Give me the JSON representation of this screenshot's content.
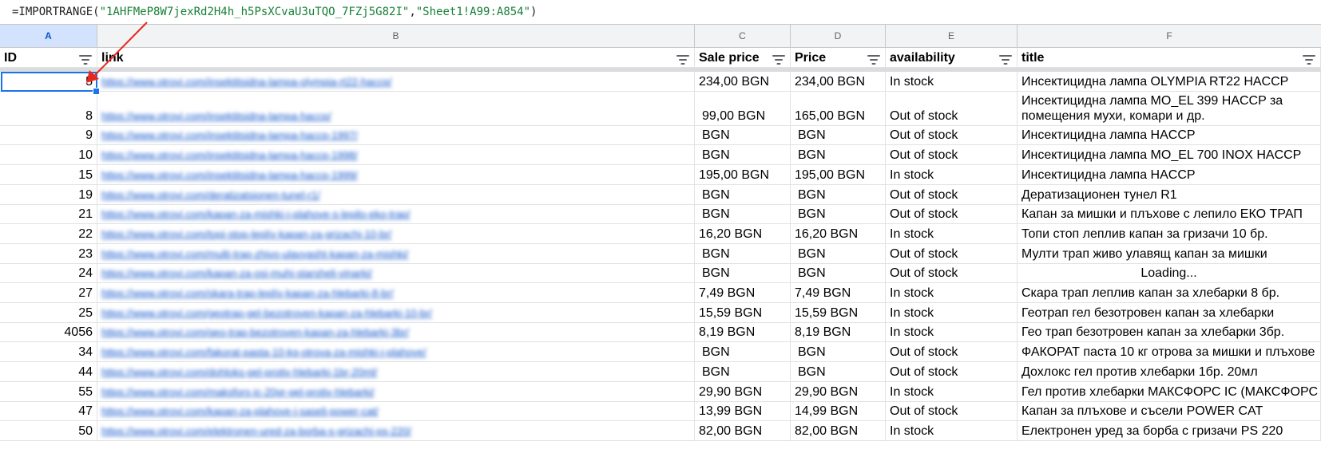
{
  "formula": {
    "prefix": "=IMPORTRANGE(",
    "arg1": "\"1AHFMeP8W7jexRd2H4h_h5PsXCvaU3uTQO_7FZj5G82I\"",
    "sep": ",",
    "arg2": "\"Sheet1!A99:A854\"",
    "suffix": ")"
  },
  "columns": [
    "A",
    "B",
    "C",
    "D",
    "E",
    "F"
  ],
  "headers": [
    "ID",
    "link",
    "Sale price",
    "Price",
    "availability",
    "title"
  ],
  "rows": [
    {
      "id": "5",
      "link": "https://www.otrovi.com/insektitsidna-lampa-olympia-rt22-haccp/",
      "sale": "234,00 BGN",
      "price": "234,00 BGN",
      "avail": "In stock",
      "title": "Инсектицидна лампа OLYMPIA RT22 HACCP"
    },
    {
      "id": "8",
      "link": "https://www.otrovi.com/insektitsidna-lampa-haccp/",
      "sale": "99,00 BGN",
      "price": "165,00 BGN",
      "avail": "Out of stock",
      "title": "Инсектицидна лампа MO_EL 399 HACCP за",
      "title2": "помещения мухи, комари и др."
    },
    {
      "id": "9",
      "link": "https://www.otrovi.com/insektitsidna-lampa-haccp-1997/",
      "sale": "BGN",
      "price": "BGN",
      "avail": "Out of stock",
      "title": "Инсектицидна лампа HACCP"
    },
    {
      "id": "10",
      "link": "https://www.otrovi.com/insektitsidna-lampa-haccp-1998/",
      "sale": "BGN",
      "price": "BGN",
      "avail": "Out of stock",
      "title": "Инсектицидна лампа MO_EL 700 INOX HACCP"
    },
    {
      "id": "15",
      "link": "https://www.otrovi.com/insektitsidna-lampa-haccp-1999/",
      "sale": "195,00 BGN",
      "price": "195,00 BGN",
      "avail": "In stock",
      "title": "Инсектицидна лампа HACCP"
    },
    {
      "id": "19",
      "link": "https://www.otrovi.com/deratizatsionen-tunel-r1/",
      "sale": "BGN",
      "price": "BGN",
      "avail": "Out of stock",
      "title": "Дератизационен тунел R1"
    },
    {
      "id": "21",
      "link": "https://www.otrovi.com/kapan-za-mishki-i-plahove-s-lepilo-eko-trap/",
      "sale": "BGN",
      "price": "BGN",
      "avail": "Out of stock",
      "title": "Капан за мишки и плъхове с лепило ЕКО ТРАП"
    },
    {
      "id": "22",
      "link": "https://www.otrovi.com/topi-stop-leplív-kapan-za-grizachi-10-br/",
      "sale": "16,20  BGN",
      "price": "16,20  BGN",
      "avail": "In stock",
      "title": "Топи стоп леплив капан за гризачи 10 бр."
    },
    {
      "id": "23",
      "link": "https://www.otrovi.com/multi-trap-zhivo-ulavyasht-kapan-za-mishki/",
      "sale": "BGN",
      "price": "BGN",
      "avail": "Out of stock",
      "title": "Мулти трап живо улавящ капан за мишки"
    },
    {
      "id": "24",
      "link": "https://www.otrovi.com/kapan-za-osi-muhi-starsheli-vinarki/",
      "sale": "BGN",
      "price": "BGN",
      "avail": "Out of stock",
      "title": "Loading...",
      "loading": true
    },
    {
      "id": "27",
      "link": "https://www.otrovi.com/skara-trap-leplív-kapan-za-hlebarki-8-br/",
      "sale": "7,49  BGN",
      "price": "7,49  BGN",
      "avail": "In stock",
      "title": "Скара трап леплив капан за хлебарки 8 бр."
    },
    {
      "id": "25",
      "link": "https://www.otrovi.com/geotrap-gel-bezotroven-kapan-za-hlebarki-10-br/",
      "sale": "15,59  BGN",
      "price": "15,59  BGN",
      "avail": "In stock",
      "title": "Геотрап гел безотровен капан за хлебарки"
    },
    {
      "id": "4056",
      "link": "https://www.otrovi.com/geo-trap-bezotroven-kapan-za-hlebarki-3br/",
      "sale": "8,19  BGN",
      "price": "8,19  BGN",
      "avail": "In stock",
      "title": "Гео трап безотровен капан за хлебарки 3бр."
    },
    {
      "id": "34",
      "link": "https://www.otrovi.com/fakorat-pasta-10-kg-otrova-za-mishki-i-plahove/",
      "sale": "BGN",
      "price": "BGN",
      "avail": "Out of stock",
      "title": "ФАКОРАТ паста 10 кг отрова за мишки и плъхове"
    },
    {
      "id": "44",
      "link": "https://www.otrovi.com/dohloks-gel-protiv-hlebarki-1br-20ml/",
      "sale": "BGN",
      "price": "BGN",
      "avail": "Out of stock",
      "title": "Дохлокс гел против хлебарки 1бр. 20мл"
    },
    {
      "id": "55",
      "link": "https://www.otrovi.com/maksfors-ic-20gr-gel-protiv-hlebarki/",
      "sale": "29,90  BGN",
      "price": "29,90  BGN",
      "avail": "In stock",
      "title": "Гел против хлебарки МАКСФОРС IC (МАКСФОРС"
    },
    {
      "id": "47",
      "link": "https://www.otrovi.com/kapan-za-plahove-i-saseli-power-cat/",
      "sale": "13,99  BGN",
      "price": "14,99  BGN",
      "avail": "Out of stock",
      "title": "Капан за плъхове и съсели POWER CAT"
    },
    {
      "id": "50",
      "link": "https://www.otrovi.com/elektronen-ured-za-borba-s-grizachi-ps-220/",
      "sale": "82,00  BGN",
      "price": "82,00  BGN",
      "avail": "In stock",
      "title": "Електронен уред за борба с гризачи PS 220"
    }
  ]
}
